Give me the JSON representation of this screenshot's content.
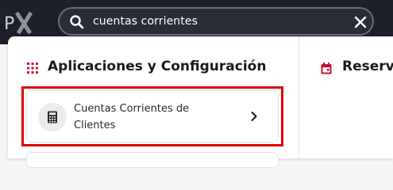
{
  "search": {
    "value": "cuentas corrientes"
  },
  "sections": [
    {
      "title": "Aplicaciones y Configuración",
      "icon": "apps-grid-icon"
    },
    {
      "title": "Reservas",
      "icon": "calendar-icon"
    }
  ],
  "results": [
    {
      "label": "Cuentas Corrientes de Clientes",
      "icon": "calculator-icon",
      "highlighted": true
    }
  ],
  "colors": {
    "topbar": "#1d1f2b",
    "accent": "#c8102e",
    "highlight": "#e00000"
  }
}
